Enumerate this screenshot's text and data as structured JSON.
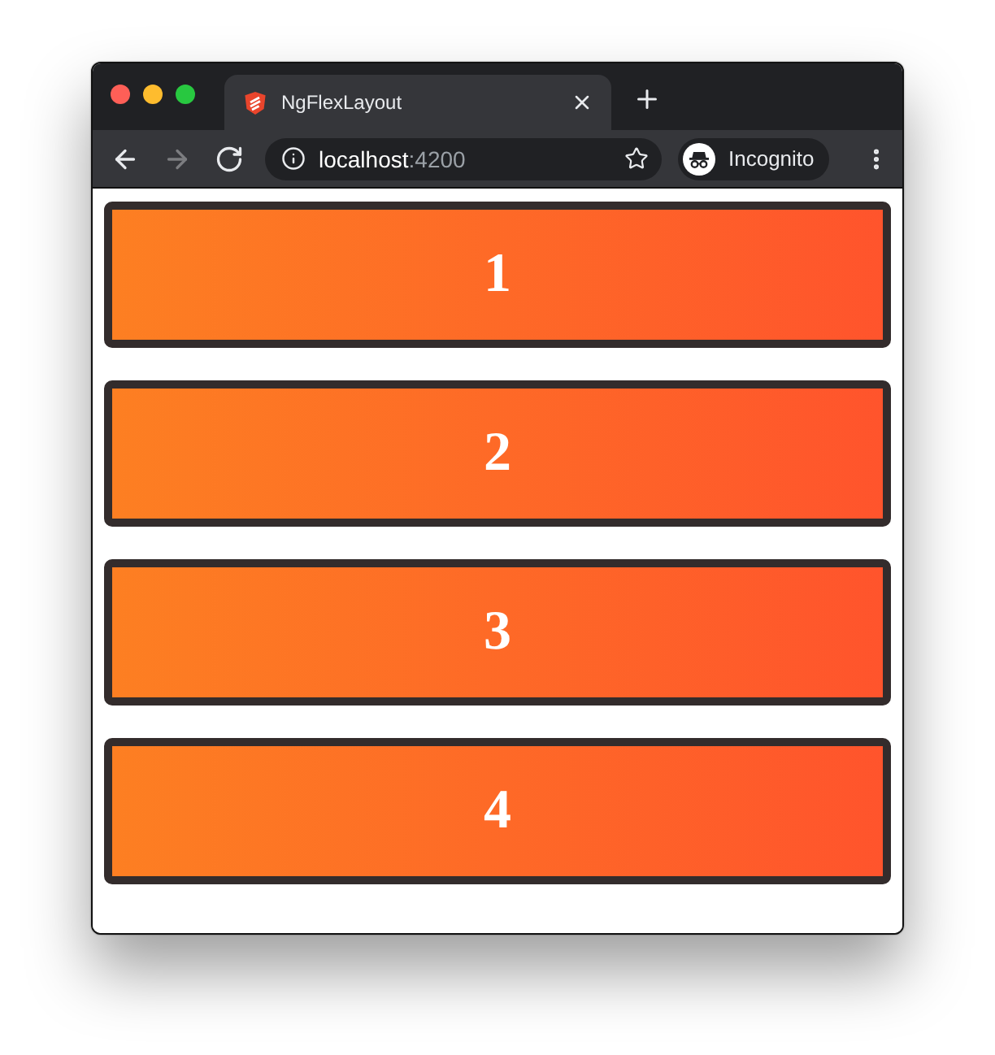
{
  "tabs": [
    {
      "title": "NgFlexLayout",
      "selected": true
    }
  ],
  "toolbar": {
    "nav_buttons": [
      {
        "kind": "back",
        "disabled": false
      },
      {
        "kind": "forward",
        "disabled": true
      },
      {
        "kind": "reload",
        "disabled": false
      }
    ],
    "address": {
      "host": "localhost",
      "port": ":4200"
    },
    "profile": "Incognito"
  },
  "boxes": [
    {
      "label": "1"
    },
    {
      "label": "2"
    },
    {
      "label": "3"
    },
    {
      "label": "4"
    }
  ]
}
